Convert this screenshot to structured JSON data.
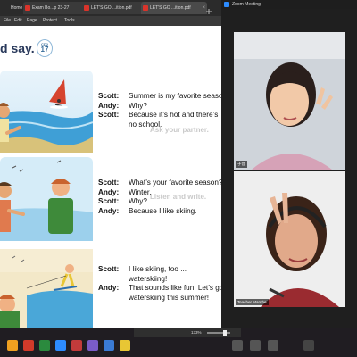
{
  "pdf": {
    "tabs": [
      {
        "label": "Home"
      },
      {
        "label": "Exam Bo...p 23-27"
      },
      {
        "label": "LET'S GO ...ition.pdf"
      },
      {
        "label": "LET'S GO ...ition.pdf"
      }
    ],
    "menu": [
      "File",
      "Edit",
      "Page",
      "Protect",
      "Tools"
    ],
    "heading": "d say.",
    "cd_badge": {
      "line1": "CD2",
      "line2": "17"
    },
    "faint_texts": [
      "Ask your partner.",
      "Listen and write."
    ],
    "dialog_1": [
      {
        "speaker": "Scott:",
        "text": "Summer is my favorite season."
      },
      {
        "speaker": "Andy:",
        "text": "Why?"
      },
      {
        "speaker": "Scott:",
        "text": "Because it’s hot and there’s"
      },
      {
        "speaker": "",
        "text": "no school."
      }
    ],
    "dialog_2": [
      {
        "speaker": "Scott:",
        "text": "What’s your favorite season?"
      },
      {
        "speaker": "Andy:",
        "text": "Winter."
      },
      {
        "speaker": "Scott:",
        "text": "Why?"
      },
      {
        "speaker": "Andy:",
        "text": "Because I like skiing."
      }
    ],
    "dialog_3": [
      {
        "speaker": "Scott:",
        "text": "I like skiing, too ..."
      },
      {
        "speaker": "",
        "text": "waterskiing!"
      },
      {
        "speaker": "Andy:",
        "text": "That sounds like fun. Let’s go"
      },
      {
        "speaker": "",
        "text": "waterskiing this summer!"
      }
    ]
  },
  "zoom": {
    "title": "Zoom Meeting",
    "participants": [
      {
        "name": "子昔"
      },
      {
        "name": "Teacher Marnhe"
      }
    ]
  },
  "acrobat": {
    "zoom_level": "133%"
  },
  "colors": {
    "accent": "#2a3a5c",
    "pdf_icon": "#d9342b"
  }
}
